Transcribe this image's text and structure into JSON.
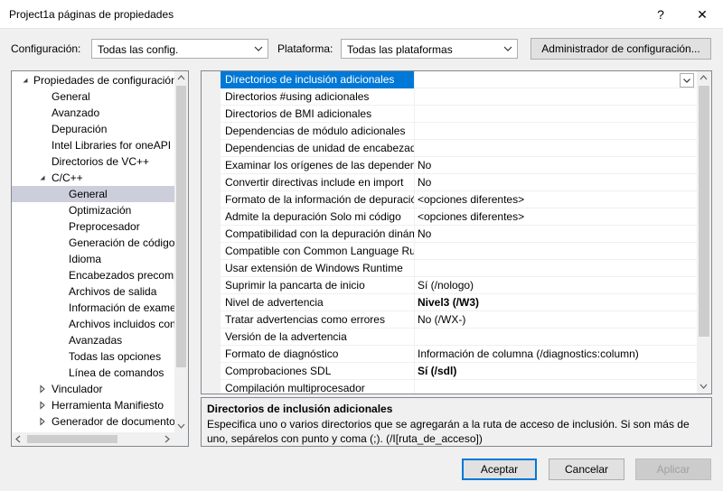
{
  "window": {
    "title": "Project1a páginas de propiedades",
    "help_glyph": "?",
    "close_glyph": "✕"
  },
  "toolbar": {
    "config_label": "Configuración:",
    "config_value": "Todas las config.",
    "platform_label": "Plataforma:",
    "platform_value": "Todas las plataformas",
    "config_manager_button": "Administrador de configuración..."
  },
  "tree": {
    "items": [
      {
        "label": "Propiedades de configuración",
        "level": 0,
        "arrow": "expanded"
      },
      {
        "label": "General",
        "level": 1
      },
      {
        "label": "Avanzado",
        "level": 1
      },
      {
        "label": "Depuración",
        "level": 1
      },
      {
        "label": "Intel Libraries for oneAPI",
        "level": 1
      },
      {
        "label": "Directorios de VC++",
        "level": 1
      },
      {
        "label": "C/C++",
        "level": 1,
        "arrow": "expanded"
      },
      {
        "label": "General",
        "level": 2,
        "selected": true
      },
      {
        "label": "Optimización",
        "level": 2
      },
      {
        "label": "Preprocesador",
        "level": 2
      },
      {
        "label": "Generación de código",
        "level": 2
      },
      {
        "label": "Idioma",
        "level": 2
      },
      {
        "label": "Encabezados precompilados",
        "level": 2
      },
      {
        "label": "Archivos de salida",
        "level": 2
      },
      {
        "label": "Información de examen",
        "level": 2
      },
      {
        "label": "Archivos incluidos conjuntamente",
        "level": 2
      },
      {
        "label": "Avanzadas",
        "level": 2
      },
      {
        "label": "Todas las opciones",
        "level": 2
      },
      {
        "label": "Línea de comandos",
        "level": 2
      },
      {
        "label": "Vinculador",
        "level": 1,
        "arrow": "collapsed"
      },
      {
        "label": "Herramienta Manifiesto",
        "level": 1,
        "arrow": "collapsed"
      },
      {
        "label": "Generador de documentos XML",
        "level": 1,
        "arrow": "collapsed"
      }
    ]
  },
  "properties": {
    "rows": [
      {
        "name": "Directorios de inclusión adicionales",
        "value": "",
        "selected": true
      },
      {
        "name": "Directorios #using adicionales",
        "value": ""
      },
      {
        "name": "Directorios de BMI adicionales",
        "value": ""
      },
      {
        "name": "Dependencias de módulo adicionales",
        "value": ""
      },
      {
        "name": "Dependencias de unidad de encabezado adicionales",
        "value": ""
      },
      {
        "name": "Examinar los orígenes de las dependencias de módulo",
        "value": "No"
      },
      {
        "name": "Convertir directivas include en import",
        "value": "No"
      },
      {
        "name": "Formato de la información de depuración",
        "value": "<opciones diferentes>"
      },
      {
        "name": "Admite la depuración Solo mi código",
        "value": "<opciones diferentes>"
      },
      {
        "name": "Compatibilidad con la depuración dinámica",
        "value": "No"
      },
      {
        "name": "Compatible con Common Language Runtime",
        "value": ""
      },
      {
        "name": "Usar extensión de Windows Runtime",
        "value": ""
      },
      {
        "name": "Suprimir la pancarta de inicio",
        "value": "Sí (/nologo)"
      },
      {
        "name": "Nivel de advertencia",
        "value": "Nivel3 (/W3)",
        "bold": true
      },
      {
        "name": "Tratar advertencias como errores",
        "value": "No (/WX-)"
      },
      {
        "name": "Versión de la advertencia",
        "value": ""
      },
      {
        "name": "Formato de diagnóstico",
        "value": "Información de columna (/diagnostics:column)"
      },
      {
        "name": "Comprobaciones SDL",
        "value": "Sí (/sdl)",
        "bold": true
      },
      {
        "name": "Compilación multiprocesador",
        "value": ""
      }
    ]
  },
  "description": {
    "title": "Directorios de inclusión adicionales",
    "text": "Especifica uno o varios directorios que se agregarán a la ruta de acceso de inclusión. Si son más de uno, sepárelos con punto y coma (;). (/I[ruta_de_acceso])"
  },
  "footer": {
    "ok_button": "Aceptar",
    "cancel_button": "Cancelar",
    "apply_button": "Aplicar"
  }
}
